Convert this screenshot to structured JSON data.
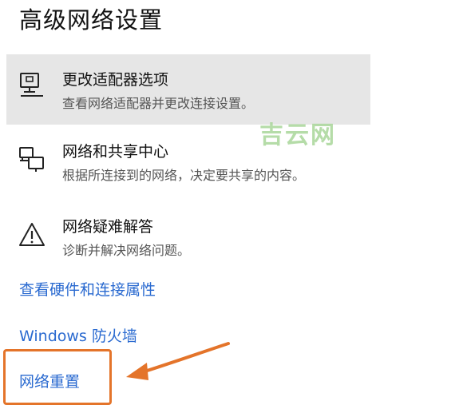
{
  "page": {
    "title": "高级网络设置"
  },
  "items": [
    {
      "name": "更改适配器选项",
      "description": "查看网络适配器并更改连接设置。",
      "icon": "monitor-network-icon",
      "highlighted": true
    },
    {
      "name": "网络和共享中心",
      "description": "根据所连接到的网络，决定要共享的内容。",
      "icon": "network-sharing-icon",
      "highlighted": false
    },
    {
      "name": "网络疑难解答",
      "description": "诊断并解决网络问题。",
      "icon": "warning-icon",
      "highlighted": false
    }
  ],
  "links": {
    "hardware_properties": "查看硬件和连接属性",
    "firewall": "Windows 防火墙",
    "network_reset": "网络重置"
  },
  "watermark": {
    "text": "吉云网"
  },
  "colors": {
    "link": "#2a6ad0",
    "highlight_bg": "#e6e6e6",
    "callout": "#e4742a",
    "watermark": "#a9d69a"
  }
}
